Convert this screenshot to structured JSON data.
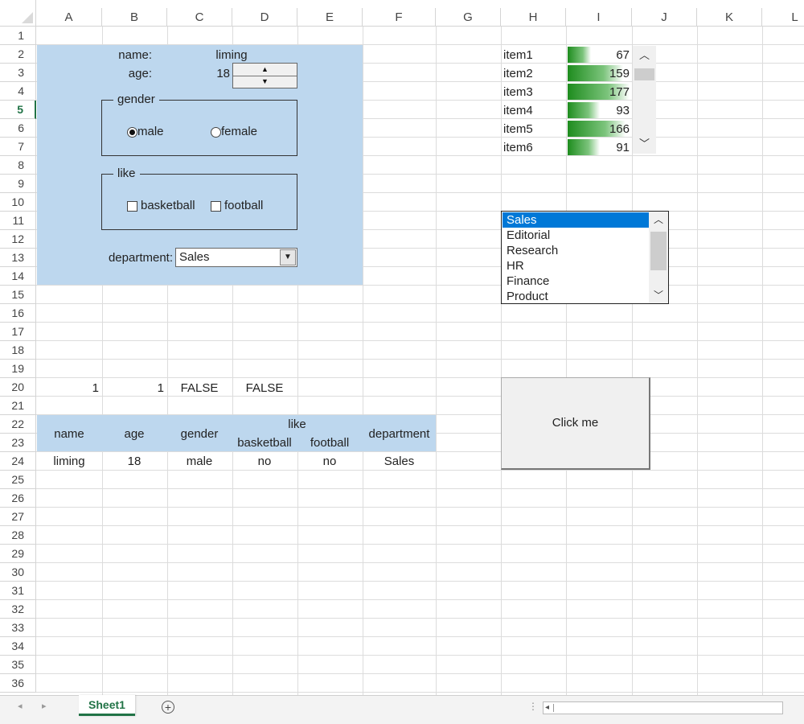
{
  "sheet": {
    "columns": [
      "A",
      "B",
      "C",
      "D",
      "E",
      "F",
      "G",
      "H",
      "I",
      "J",
      "K",
      "L"
    ],
    "rows": [
      "1",
      "2",
      "3",
      "4",
      "5",
      "6",
      "7",
      "8",
      "9",
      "10",
      "11",
      "12",
      "13",
      "14",
      "15",
      "16",
      "17",
      "18",
      "19",
      "20",
      "21",
      "22",
      "23",
      "24",
      "25",
      "26",
      "27",
      "28",
      "29",
      "30",
      "31",
      "32",
      "33",
      "34",
      "35",
      "36"
    ],
    "active_row": "5"
  },
  "form": {
    "name_label": "name:",
    "name_value": "liming",
    "age_label": "age:",
    "age_value": "18",
    "gender_legend": "gender",
    "gender_male": "male",
    "gender_female": "female",
    "gender_selected": "male",
    "like_legend": "like",
    "like_basketball": "basketball",
    "like_football": "football",
    "department_label": "department:",
    "department_value": "Sales"
  },
  "row20": [
    "1",
    "1",
    "FALSE",
    "FALSE"
  ],
  "summary_table": {
    "headers": {
      "name": "name",
      "age": "age",
      "gender": "gender",
      "like": "like",
      "basketball": "basketball",
      "football": "football",
      "department": "department"
    },
    "values": {
      "name": "liming",
      "age": "18",
      "gender": "male",
      "basketball": "no",
      "football": "no",
      "department": "Sales"
    }
  },
  "items": [
    {
      "label": "item1",
      "value": "67"
    },
    {
      "label": "item2",
      "value": "159"
    },
    {
      "label": "item3",
      "value": "177"
    },
    {
      "label": "item4",
      "value": "93"
    },
    {
      "label": "item5",
      "value": "166"
    },
    {
      "label": "item6",
      "value": "91"
    }
  ],
  "databar_color": "#1e8c1e",
  "listbox": {
    "options": [
      "Sales",
      "Editorial",
      "Research",
      "HR",
      "Finance",
      "Product"
    ],
    "selected": "Sales"
  },
  "button_label": "Click me",
  "sheet_tab": "Sheet1",
  "accent": "#217346",
  "header_fill": "#bdd7ee",
  "icons": {
    "up": "^",
    "down": "v",
    "add": "+",
    "left": "◂",
    "right": "▸",
    "dropdown": "▼"
  }
}
